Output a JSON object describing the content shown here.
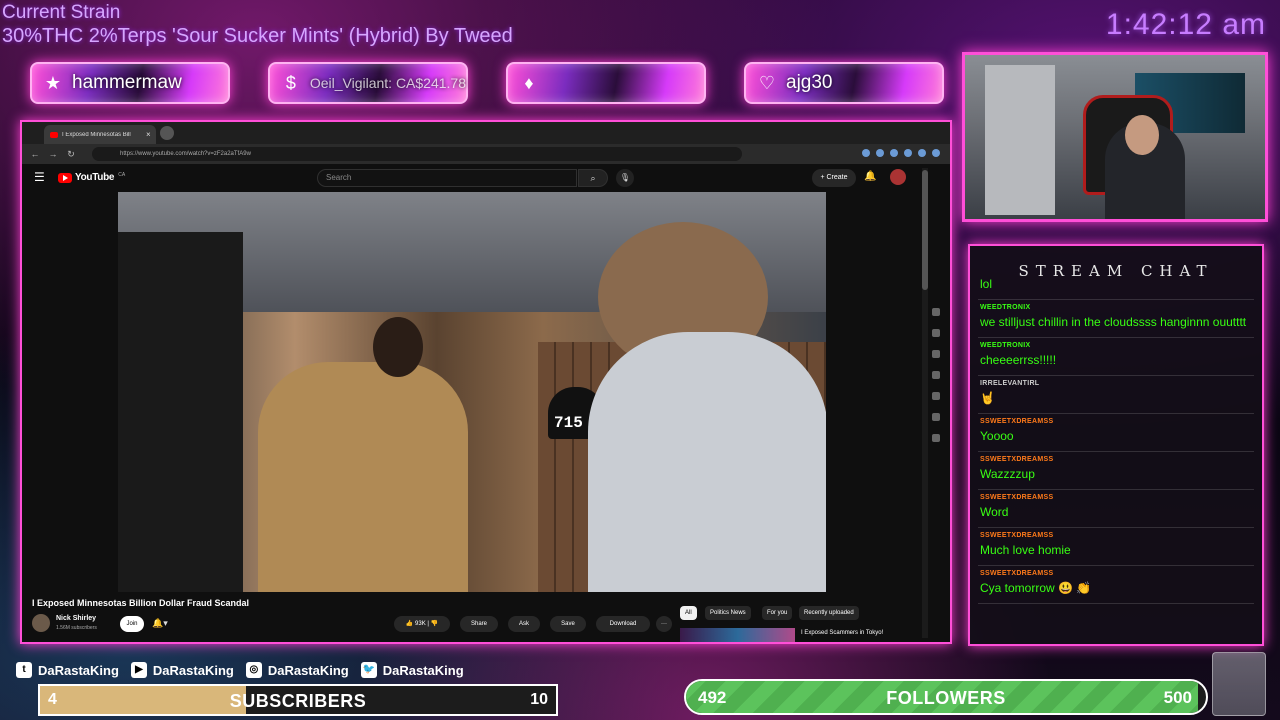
{
  "overlay": {
    "strain_title": "Current Strain",
    "strain_detail": "30%THC 2%Terps 'Sour Sucker Mints' (Hybrid) By  Tweed",
    "clock": "1:42:12 am"
  },
  "alerts": [
    {
      "icon": "star-icon",
      "glyph": "★",
      "text": "hammermaw"
    },
    {
      "icon": "dollar-icon",
      "glyph": "$",
      "text": "Oeil_Vigilant: CA$241.78"
    },
    {
      "icon": "diamond-icon",
      "glyph": "♦",
      "text": ""
    },
    {
      "icon": "heart-icon",
      "glyph": "♡",
      "text": "ajg30"
    }
  ],
  "browser": {
    "tab_title": "I Exposed Minnesotas Bill",
    "tab_close": "×",
    "url": "https://www.youtube.com/watch?v=zF2a2aTfA9w"
  },
  "youtube": {
    "logo_text": "YouTube",
    "logo_region": "CA",
    "search_placeholder": "Search",
    "create_label": "+ Create",
    "video_box_number": "715",
    "video_title": "I Exposed Minnesotas Billion Dollar Fraud Scandal",
    "channel_name": "Nick Shirley",
    "channel_subs": "1.56M subscribers",
    "join_label": "Join",
    "actions": {
      "like": "93K",
      "share": "Share",
      "ask": "Ask",
      "save": "Save",
      "download": "Download",
      "more": "···"
    },
    "chips": [
      "All",
      "Politics News",
      "For you",
      "Recently uploaded"
    ],
    "recommended_title": "I Exposed Scammers in Tokyo!"
  },
  "chat": {
    "title": "STREAM CHAT",
    "messages": [
      {
        "user": "",
        "text": "lol",
        "color": "#ff7a1a"
      },
      {
        "user": "WEEDTRONIX",
        "text": "we stilljust chillin in the cloudssss hanginnn ouutttt",
        "color": "#39ff14"
      },
      {
        "user": "WEEDTRONIX",
        "text": "cheeeerrss!!!!!",
        "color": "#39ff14"
      },
      {
        "user": "IRRELEVANTIRL",
        "text": "🤘",
        "color": "#cccccc"
      },
      {
        "user": "SSWEETXDREAMSS",
        "text": "Yoooo",
        "color": "#ff7a1a"
      },
      {
        "user": "SSWEETXDREAMSS",
        "text": "Wazzzzup",
        "color": "#ff7a1a"
      },
      {
        "user": "SSWEETXDREAMSS",
        "text": "Word",
        "color": "#ff7a1a"
      },
      {
        "user": "SSWEETXDREAMSS",
        "text": "Much love homie",
        "color": "#ff7a1a"
      },
      {
        "user": "SSWEETXDREAMSS",
        "text": "Cya tomorrow 😃 👏",
        "color": "#ff7a1a"
      }
    ]
  },
  "socials": [
    {
      "icon": "twitch-icon",
      "glyph": "t",
      "name": "DaRastaKing"
    },
    {
      "icon": "youtube-icon",
      "glyph": "▶",
      "name": "DaRastaKing"
    },
    {
      "icon": "instagram-icon",
      "glyph": "◎",
      "name": "DaRastaKing"
    },
    {
      "icon": "twitter-icon",
      "glyph": "🐦",
      "name": "DaRastaKing"
    }
  ],
  "subscribers": {
    "current": "4",
    "label": "SUBSCRIBERS",
    "goal": "10",
    "progress": 0.4
  },
  "followers": {
    "current": "492",
    "label": "FOLLOWERS",
    "goal": "500",
    "progress": 0.984
  }
}
